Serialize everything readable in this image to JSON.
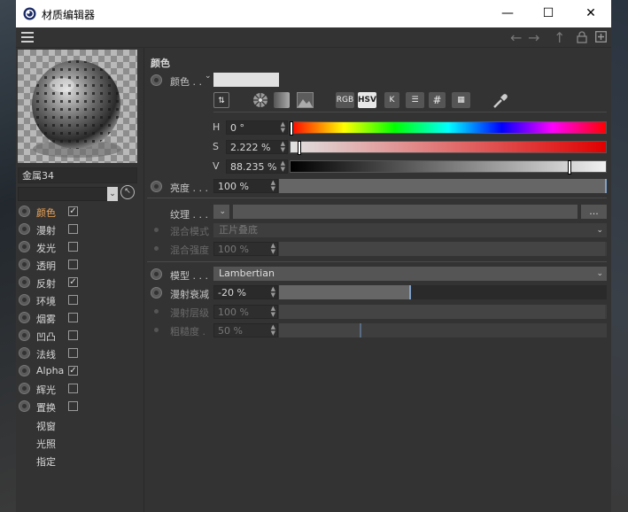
{
  "window": {
    "title": "材质编辑器",
    "minimize": "—",
    "maximize": "☐",
    "close": "✕"
  },
  "material": {
    "name": "金属34"
  },
  "channels": [
    {
      "label": "颜色",
      "checked": true,
      "selected": true
    },
    {
      "label": "漫射",
      "checked": false
    },
    {
      "label": "发光",
      "checked": false
    },
    {
      "label": "透明",
      "checked": false
    },
    {
      "label": "反射",
      "checked": true
    },
    {
      "label": "环境",
      "checked": false
    },
    {
      "label": "烟雾",
      "checked": false
    },
    {
      "label": "凹凸",
      "checked": false
    },
    {
      "label": "法线",
      "checked": false
    },
    {
      "label": "Alpha",
      "checked": true
    },
    {
      "label": "辉光",
      "checked": false
    },
    {
      "label": "置换",
      "checked": false
    }
  ],
  "extra_channels": [
    "视窗",
    "光照",
    "指定"
  ],
  "color_section": {
    "title": "颜色",
    "color_label": "颜色 . .",
    "swatch_color": "#e1e1e1",
    "mode_buttons": [
      "RGB",
      "HSV",
      "K"
    ],
    "active_mode": "HSV",
    "h": {
      "label": "H",
      "value": "0 °"
    },
    "s": {
      "label": "S",
      "value": "2.222 %"
    },
    "v": {
      "label": "V",
      "value": "88.235 %"
    },
    "s_value": 0.022,
    "v_value": 0.882,
    "brightness": {
      "label": "亮度 . . .",
      "value": "100 %"
    },
    "texture": {
      "label": "纹理 . . .",
      "button": "..."
    },
    "blend_mode": {
      "label": "混合模式",
      "value": "正片叠底"
    },
    "blend_strength": {
      "label": "混合强度",
      "value": "100 %"
    }
  },
  "diffuse_section": {
    "model": {
      "label": "模型 . . .",
      "value": "Lambertian"
    },
    "falloff": {
      "label": "漫射衰减",
      "value": "-20 %"
    },
    "level": {
      "label": "漫射层级",
      "value": "100 %"
    },
    "roughness": {
      "label": "粗糙度 .",
      "value": "50 %"
    }
  },
  "colors": {
    "accent_selected": "#f0a75a",
    "slider_mark": "#7fa1c8"
  }
}
